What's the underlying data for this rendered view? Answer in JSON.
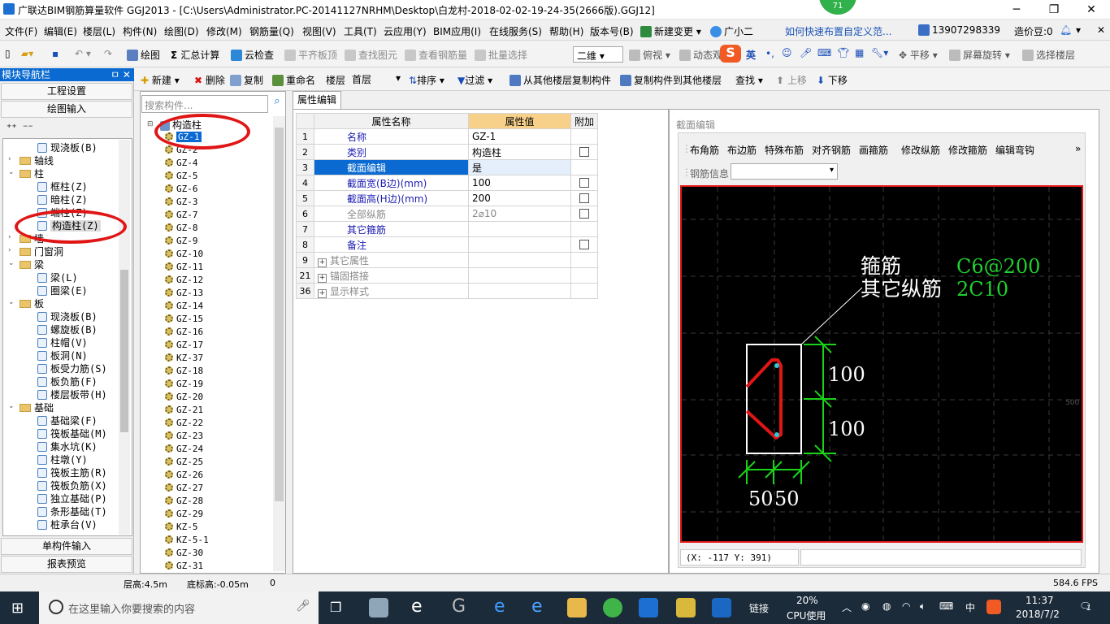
{
  "app": {
    "title": "广联达BIM钢筋算量软件 GGJ2013 - [C:\\Users\\Administrator.PC-20141127NRHM\\Desktop\\白龙村-2018-02-02-19-24-35(2666版).GGJ12]",
    "badge": "71",
    "minimize": "─",
    "restore": "❐",
    "close": "✕"
  },
  "menu": {
    "items": [
      "文件(F)",
      "编辑(E)",
      "楼层(L)",
      "构件(N)",
      "绘图(D)",
      "修改(M)",
      "钢筋量(Q)",
      "视图(V)",
      "工具(T)",
      "云应用(Y)",
      "BIM应用(I)",
      "在线服务(S)",
      "帮助(H)",
      "版本号(B)"
    ],
    "new_change": "新建变更",
    "guangxiaoer": "广小二",
    "tip_link": "如何快速布置自定义范...",
    "phone": "13907298339",
    "zaojiadou": "造价豆:0"
  },
  "toolbar1": {
    "draw": "绘图",
    "sum": "汇总计算",
    "cloud_check": "云检查",
    "flat_top": "平齐板顶",
    "find_elem": "查找图元",
    "view_rebar": "查看钢筋量",
    "batch_select": "批量选择",
    "view_mode": "二维",
    "top_view": "俯视",
    "dynamic": "动态观",
    "ying": "英",
    "pan": "平移",
    "rotate": "屏幕旋转",
    "select_floor": "选择楼层"
  },
  "toolbar2": {
    "new": "新建",
    "delete": "删除",
    "copy": "复制",
    "rename": "重命名",
    "floor_label": "楼层",
    "floor_value": "首层",
    "sort": "排序",
    "filter": "过滤",
    "copy_from": "从其他楼层复制构件",
    "copy_to": "复制构件到其他楼层",
    "find": "查找",
    "move_up": "上移",
    "move_down": "下移"
  },
  "nav": {
    "header": "模块导航栏",
    "pin": "ㅁ ✕",
    "project_settings": "工程设置",
    "drawing_input": "绘图输入",
    "single_input": "单构件输入",
    "report_preview": "报表预览",
    "tree": [
      {
        "label": "现浇板(B)",
        "indent": 3
      },
      {
        "label": "轴线",
        "indent": 1,
        "folder": true,
        "exp": "+"
      },
      {
        "label": "柱",
        "indent": 1,
        "folder": true,
        "exp": "−"
      },
      {
        "label": "框柱(Z)",
        "indent": 3
      },
      {
        "label": "暗柱(Z)",
        "indent": 3
      },
      {
        "label": "端柱(Z)",
        "indent": 3
      },
      {
        "label": "构造柱(Z)",
        "indent": 3,
        "selected": true
      },
      {
        "label": "墙",
        "indent": 1,
        "folder": true,
        "exp": "+"
      },
      {
        "label": "门窗洞",
        "indent": 1,
        "folder": true,
        "exp": "+"
      },
      {
        "label": "梁",
        "indent": 1,
        "folder": true,
        "exp": "−"
      },
      {
        "label": "梁(L)",
        "indent": 3
      },
      {
        "label": "圈梁(E)",
        "indent": 3
      },
      {
        "label": "板",
        "indent": 1,
        "folder": true,
        "exp": "−"
      },
      {
        "label": "现浇板(B)",
        "indent": 3
      },
      {
        "label": "螺旋板(B)",
        "indent": 3
      },
      {
        "label": "柱帽(V)",
        "indent": 3
      },
      {
        "label": "板洞(N)",
        "indent": 3
      },
      {
        "label": "板受力筋(S)",
        "indent": 3
      },
      {
        "label": "板负筋(F)",
        "indent": 3
      },
      {
        "label": "楼层板带(H)",
        "indent": 3
      },
      {
        "label": "基础",
        "indent": 1,
        "folder": true,
        "exp": "−"
      },
      {
        "label": "基础梁(F)",
        "indent": 3
      },
      {
        "label": "筏板基础(M)",
        "indent": 3
      },
      {
        "label": "集水坑(K)",
        "indent": 3
      },
      {
        "label": "柱墩(Y)",
        "indent": 3
      },
      {
        "label": "筏板主筋(R)",
        "indent": 3
      },
      {
        "label": "筏板负筋(X)",
        "indent": 3
      },
      {
        "label": "独立基础(P)",
        "indent": 3
      },
      {
        "label": "条形基础(T)",
        "indent": 3
      },
      {
        "label": "桩承台(V)",
        "indent": 3
      }
    ]
  },
  "components": {
    "search_placeholder": "搜索构件...",
    "root": "构造柱",
    "items": [
      "GZ-1",
      "GZ-2",
      "GZ-4",
      "GZ-5",
      "GZ-6",
      "GZ-3",
      "GZ-7",
      "GZ-8",
      "GZ-9",
      "GZ-10",
      "GZ-11",
      "GZ-12",
      "GZ-13",
      "GZ-14",
      "GZ-15",
      "GZ-16",
      "GZ-17",
      "KZ-37",
      "GZ-18",
      "GZ-19",
      "GZ-20",
      "GZ-21",
      "GZ-22",
      "GZ-23",
      "GZ-24",
      "GZ-25",
      "GZ-26",
      "GZ-27",
      "GZ-28",
      "GZ-29",
      "KZ-5",
      "KZ-5-1",
      "GZ-30",
      "GZ-31"
    ]
  },
  "props": {
    "tab": "属性编辑",
    "col_name": "属性名称",
    "col_value": "属性值",
    "col_extra": "附加",
    "rows": [
      {
        "num": "1",
        "name": "名称",
        "value": "GZ-1",
        "check": false
      },
      {
        "num": "2",
        "name": "类别",
        "value": "构造柱",
        "check": true
      },
      {
        "num": "3",
        "name": "截面编辑",
        "value": "是",
        "check": false,
        "hl": true
      },
      {
        "num": "4",
        "name": "截面宽(B边)(mm)",
        "value": "100",
        "check": true
      },
      {
        "num": "5",
        "name": "截面高(H边)(mm)",
        "value": "200",
        "check": true
      },
      {
        "num": "6",
        "name": "全部纵筋",
        "value": "2⌀10",
        "check": true,
        "gray": true
      },
      {
        "num": "7",
        "name": "其它箍筋",
        "value": "",
        "check": false
      },
      {
        "num": "8",
        "name": "备注",
        "value": "",
        "check": true
      },
      {
        "num": "9",
        "name": "其它属性",
        "value": "",
        "check": false,
        "group": true
      },
      {
        "num": "21",
        "name": "锚固搭接",
        "value": "",
        "check": false,
        "group": true
      },
      {
        "num": "36",
        "name": "显示样式",
        "value": "",
        "check": false,
        "group": true
      }
    ]
  },
  "section": {
    "title": "截面编辑",
    "tools": [
      "布角筋",
      "布边筋",
      "特殊布筋",
      "对齐钢筋",
      "画箍筋",
      "修改纵筋",
      "修改箍筋",
      "编辑弯钩"
    ],
    "rebar_info_label": "钢筋信息",
    "stirrup_label": "箍筋",
    "stirrup_value": "C6@200",
    "long_label": "其它纵筋",
    "long_value": "2C10",
    "dim_h1": "100",
    "dim_h2": "100",
    "dim_w1": "50",
    "dim_w2": "50",
    "side_mark": "500",
    "coord": "(X: -117 Y: 391)",
    "colors": {
      "rebar": "#e01515",
      "dim": "#19d219",
      "label_green": "#1fd02e"
    }
  },
  "status": {
    "floor_height": "层高:4.5m",
    "bottom_elev": "底标高:-0.05m",
    "zero": "0",
    "fps": "584.6 FPS"
  },
  "taskbar": {
    "search": "在这里输入你要搜索的内容",
    "link": "链接",
    "cpu_pct": "20%",
    "cpu_label": "CPU使用",
    "ime": "中",
    "time": "11:37",
    "date": "2018/7/2",
    "notif": "1"
  }
}
